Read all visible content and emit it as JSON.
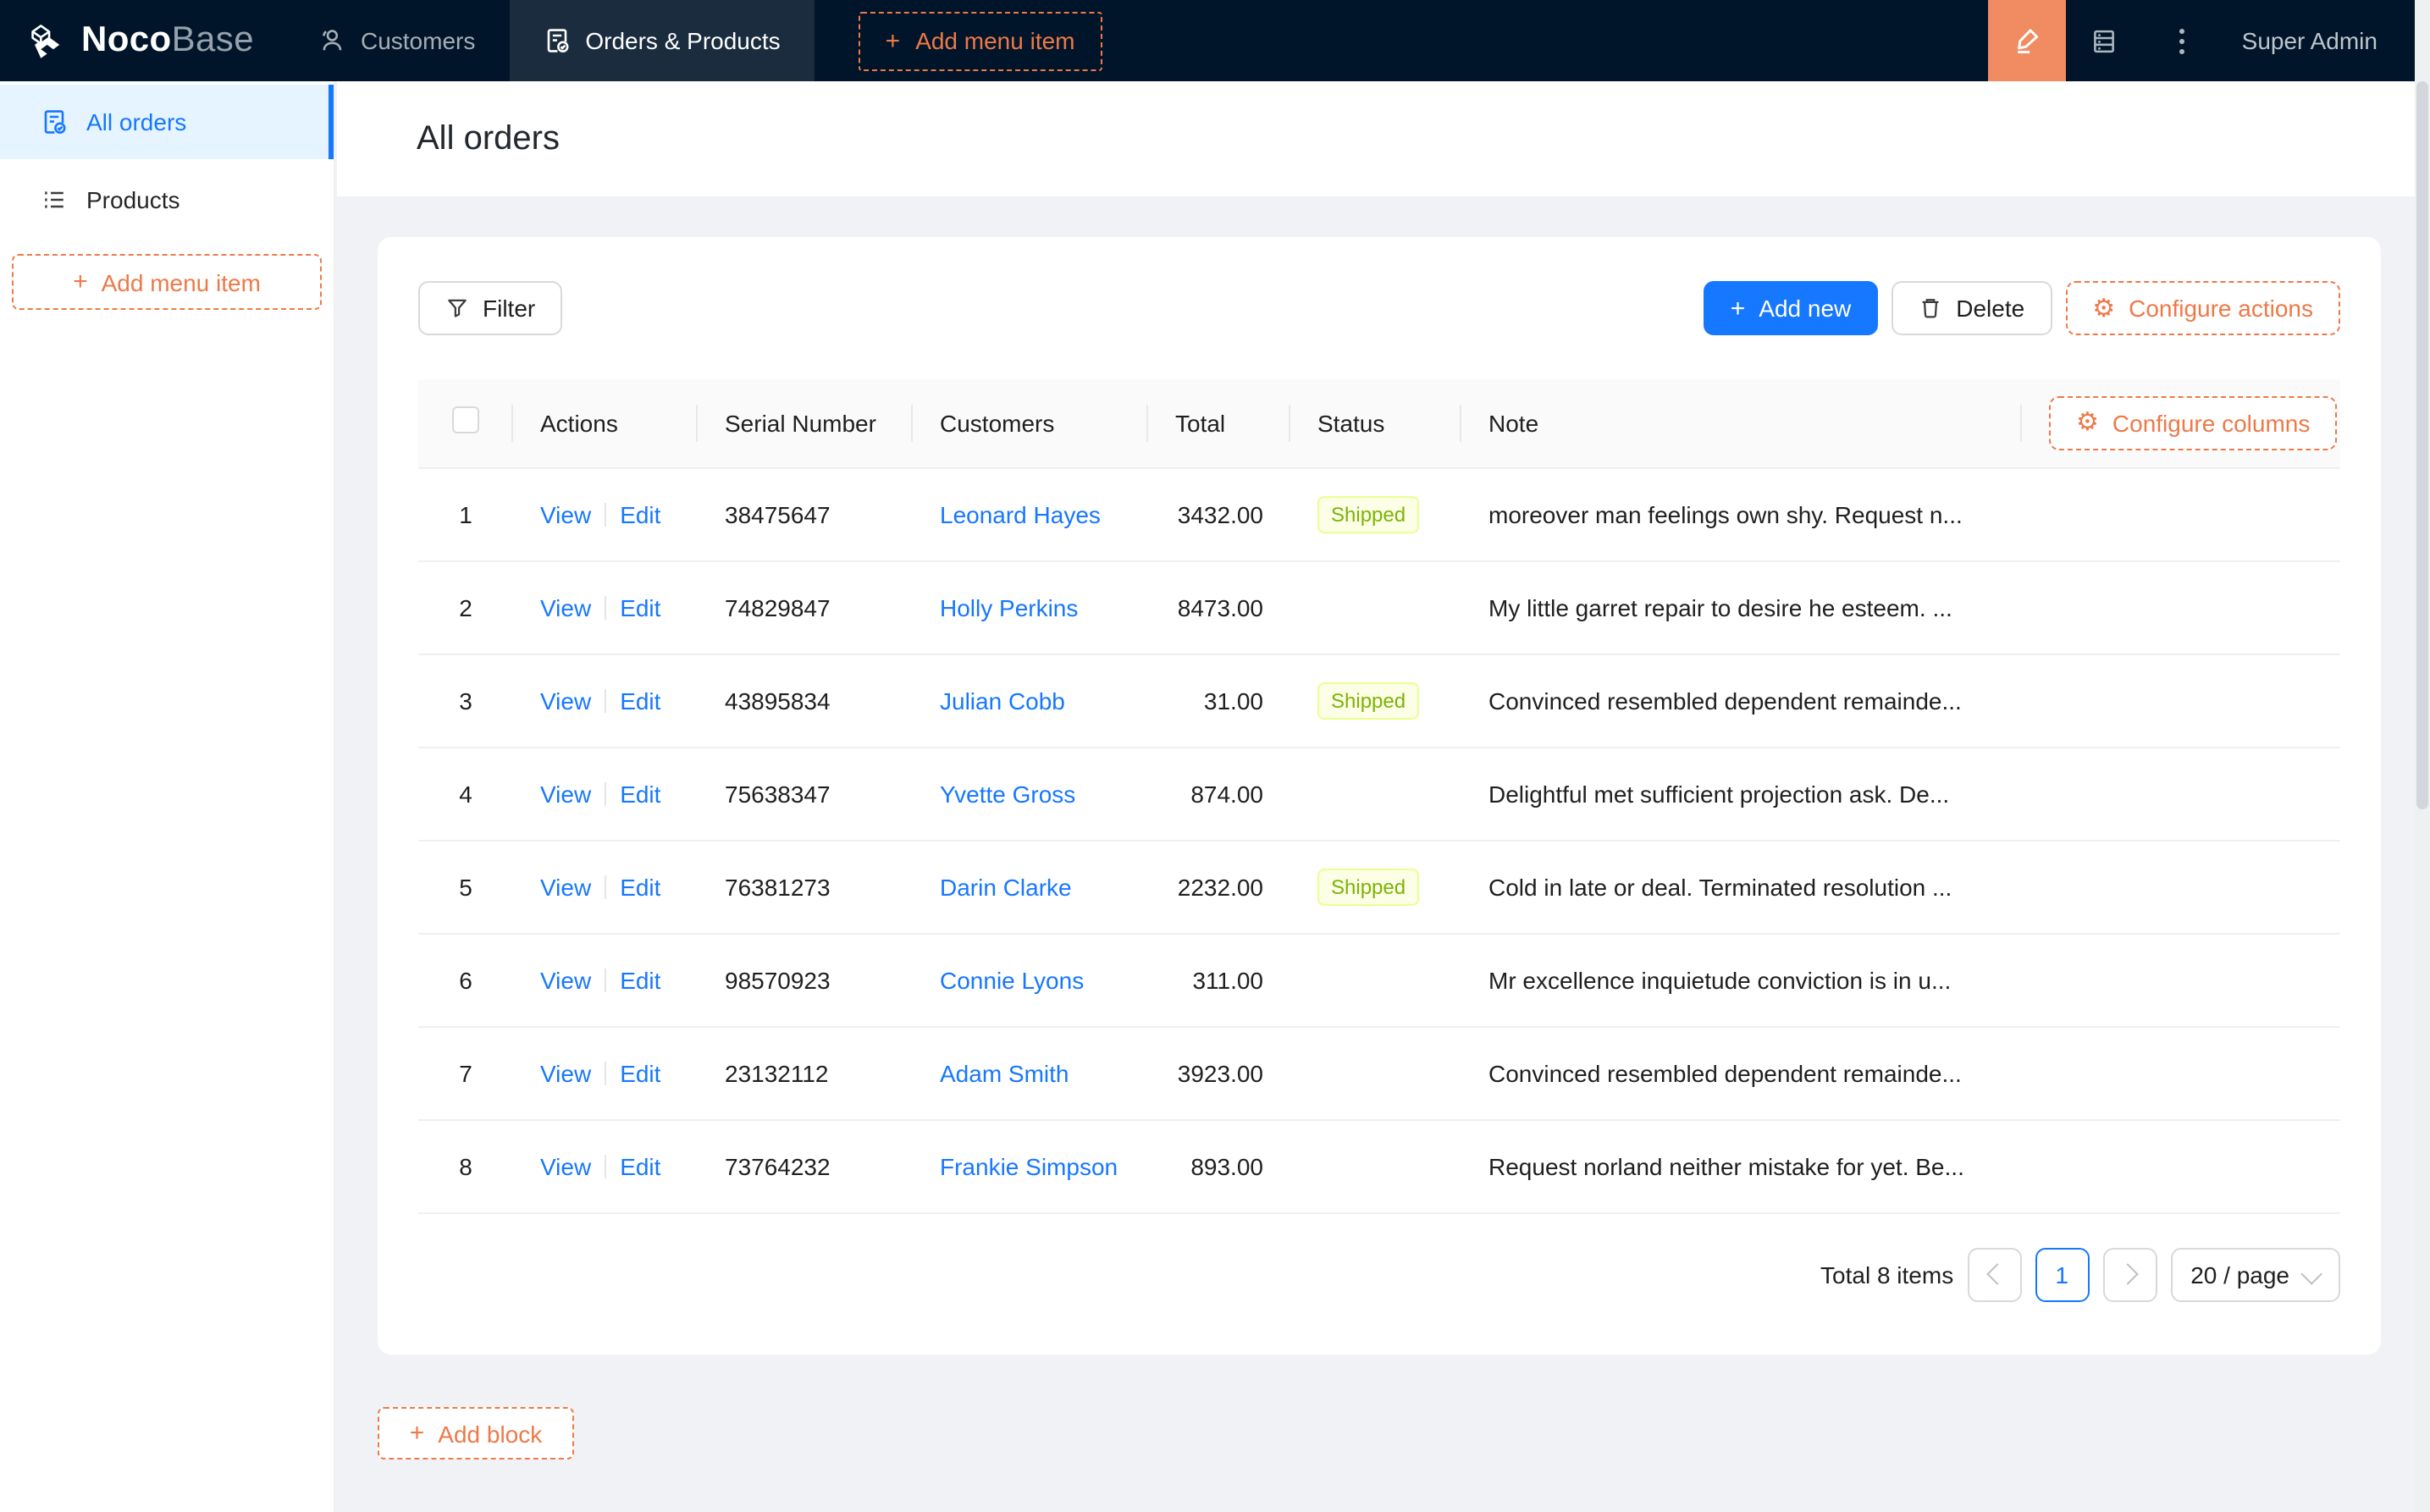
{
  "navbar": {
    "brand_bold": "Noco",
    "brand_light": "Base",
    "tabs": [
      {
        "label": "Customers",
        "icon": "user-icon",
        "active": false
      },
      {
        "label": "Orders & Products",
        "icon": "file-done-icon",
        "active": true
      }
    ],
    "add_menu_item_label": "Add menu item",
    "user_name": "Super Admin"
  },
  "sidebar": {
    "items": [
      {
        "label": "All orders",
        "icon": "file-done-icon",
        "active": true
      },
      {
        "label": "Products",
        "icon": "list-icon",
        "active": false
      }
    ],
    "add_menu_item_label": "Add menu item"
  },
  "page": {
    "title": "All orders",
    "add_block_label": "Add block"
  },
  "toolbar": {
    "filter_label": "Filter",
    "add_new_label": "Add new",
    "delete_label": "Delete",
    "configure_actions_label": "Configure actions"
  },
  "table": {
    "configure_columns_label": "Configure columns",
    "columns": [
      "Actions",
      "Serial Number",
      "Customers",
      "Total",
      "Status",
      "Note"
    ],
    "action_labels": [
      "View",
      "Edit"
    ],
    "rows": [
      {
        "index": "1",
        "serial": "38475647",
        "customer": "Leonard Hayes",
        "total": "3432.00",
        "status": "Shipped",
        "note": "moreover man feelings own shy. Request n..."
      },
      {
        "index": "2",
        "serial": "74829847",
        "customer": "Holly Perkins",
        "total": "8473.00",
        "status": "",
        "note": "My little garret repair to desire he esteem. ..."
      },
      {
        "index": "3",
        "serial": "43895834",
        "customer": "Julian Cobb",
        "total": "31.00",
        "status": "Shipped",
        "note": "Convinced resembled dependent remainde..."
      },
      {
        "index": "4",
        "serial": "75638347",
        "customer": "Yvette Gross",
        "total": "874.00",
        "status": "",
        "note": "Delightful met sufficient projection ask. De..."
      },
      {
        "index": "5",
        "serial": "76381273",
        "customer": "Darin Clarke",
        "total": "2232.00",
        "status": "Shipped",
        "note": "Cold in late or deal. Terminated resolution ..."
      },
      {
        "index": "6",
        "serial": "98570923",
        "customer": "Connie Lyons",
        "total": "311.00",
        "status": "",
        "note": "Mr excellence inquietude conviction is in u..."
      },
      {
        "index": "7",
        "serial": "23132112",
        "customer": "Adam Smith",
        "total": "3923.00",
        "status": "",
        "note": "Convinced resembled dependent remainde..."
      },
      {
        "index": "8",
        "serial": "73764232",
        "customer": "Frankie Simpson",
        "total": "893.00",
        "status": "",
        "note": "Request norland neither mistake for yet. Be..."
      }
    ]
  },
  "pagination": {
    "total_text": "Total 8 items",
    "current_page": "1",
    "page_size": "20 / page"
  },
  "colors": {
    "navbar_bg": "#001529",
    "accent_orange": "#f18b62",
    "dashed_orange": "#ee7948",
    "link_blue": "#1677ff",
    "tag_bg": "#fcffe6",
    "tag_border": "#eaff8f",
    "tag_text": "#7cb305"
  }
}
